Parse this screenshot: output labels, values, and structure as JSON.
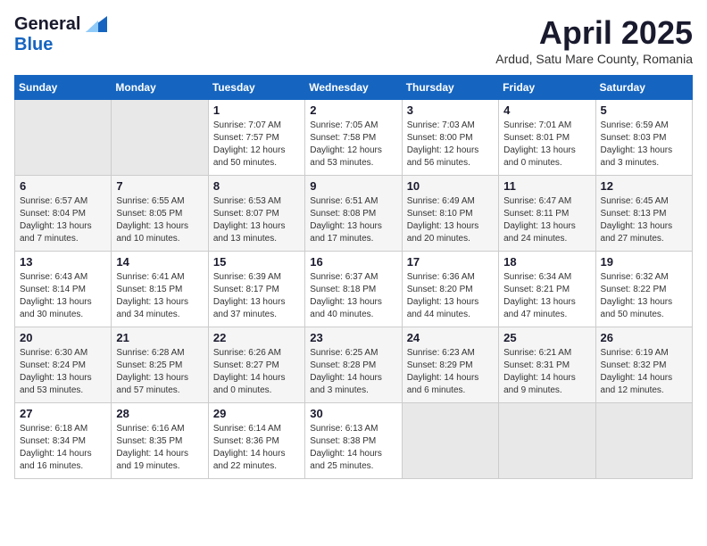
{
  "logo": {
    "general": "General",
    "blue": "Blue"
  },
  "title": {
    "month": "April 2025",
    "location": "Ardud, Satu Mare County, Romania"
  },
  "headers": [
    "Sunday",
    "Monday",
    "Tuesday",
    "Wednesday",
    "Thursday",
    "Friday",
    "Saturday"
  ],
  "weeks": [
    [
      {
        "num": "",
        "sunrise": "",
        "sunset": "",
        "daylight": ""
      },
      {
        "num": "",
        "sunrise": "",
        "sunset": "",
        "daylight": ""
      },
      {
        "num": "1",
        "sunrise": "Sunrise: 7:07 AM",
        "sunset": "Sunset: 7:57 PM",
        "daylight": "Daylight: 12 hours and 50 minutes."
      },
      {
        "num": "2",
        "sunrise": "Sunrise: 7:05 AM",
        "sunset": "Sunset: 7:58 PM",
        "daylight": "Daylight: 12 hours and 53 minutes."
      },
      {
        "num": "3",
        "sunrise": "Sunrise: 7:03 AM",
        "sunset": "Sunset: 8:00 PM",
        "daylight": "Daylight: 12 hours and 56 minutes."
      },
      {
        "num": "4",
        "sunrise": "Sunrise: 7:01 AM",
        "sunset": "Sunset: 8:01 PM",
        "daylight": "Daylight: 13 hours and 0 minutes."
      },
      {
        "num": "5",
        "sunrise": "Sunrise: 6:59 AM",
        "sunset": "Sunset: 8:03 PM",
        "daylight": "Daylight: 13 hours and 3 minutes."
      }
    ],
    [
      {
        "num": "6",
        "sunrise": "Sunrise: 6:57 AM",
        "sunset": "Sunset: 8:04 PM",
        "daylight": "Daylight: 13 hours and 7 minutes."
      },
      {
        "num": "7",
        "sunrise": "Sunrise: 6:55 AM",
        "sunset": "Sunset: 8:05 PM",
        "daylight": "Daylight: 13 hours and 10 minutes."
      },
      {
        "num": "8",
        "sunrise": "Sunrise: 6:53 AM",
        "sunset": "Sunset: 8:07 PM",
        "daylight": "Daylight: 13 hours and 13 minutes."
      },
      {
        "num": "9",
        "sunrise": "Sunrise: 6:51 AM",
        "sunset": "Sunset: 8:08 PM",
        "daylight": "Daylight: 13 hours and 17 minutes."
      },
      {
        "num": "10",
        "sunrise": "Sunrise: 6:49 AM",
        "sunset": "Sunset: 8:10 PM",
        "daylight": "Daylight: 13 hours and 20 minutes."
      },
      {
        "num": "11",
        "sunrise": "Sunrise: 6:47 AM",
        "sunset": "Sunset: 8:11 PM",
        "daylight": "Daylight: 13 hours and 24 minutes."
      },
      {
        "num": "12",
        "sunrise": "Sunrise: 6:45 AM",
        "sunset": "Sunset: 8:13 PM",
        "daylight": "Daylight: 13 hours and 27 minutes."
      }
    ],
    [
      {
        "num": "13",
        "sunrise": "Sunrise: 6:43 AM",
        "sunset": "Sunset: 8:14 PM",
        "daylight": "Daylight: 13 hours and 30 minutes."
      },
      {
        "num": "14",
        "sunrise": "Sunrise: 6:41 AM",
        "sunset": "Sunset: 8:15 PM",
        "daylight": "Daylight: 13 hours and 34 minutes."
      },
      {
        "num": "15",
        "sunrise": "Sunrise: 6:39 AM",
        "sunset": "Sunset: 8:17 PM",
        "daylight": "Daylight: 13 hours and 37 minutes."
      },
      {
        "num": "16",
        "sunrise": "Sunrise: 6:37 AM",
        "sunset": "Sunset: 8:18 PM",
        "daylight": "Daylight: 13 hours and 40 minutes."
      },
      {
        "num": "17",
        "sunrise": "Sunrise: 6:36 AM",
        "sunset": "Sunset: 8:20 PM",
        "daylight": "Daylight: 13 hours and 44 minutes."
      },
      {
        "num": "18",
        "sunrise": "Sunrise: 6:34 AM",
        "sunset": "Sunset: 8:21 PM",
        "daylight": "Daylight: 13 hours and 47 minutes."
      },
      {
        "num": "19",
        "sunrise": "Sunrise: 6:32 AM",
        "sunset": "Sunset: 8:22 PM",
        "daylight": "Daylight: 13 hours and 50 minutes."
      }
    ],
    [
      {
        "num": "20",
        "sunrise": "Sunrise: 6:30 AM",
        "sunset": "Sunset: 8:24 PM",
        "daylight": "Daylight: 13 hours and 53 minutes."
      },
      {
        "num": "21",
        "sunrise": "Sunrise: 6:28 AM",
        "sunset": "Sunset: 8:25 PM",
        "daylight": "Daylight: 13 hours and 57 minutes."
      },
      {
        "num": "22",
        "sunrise": "Sunrise: 6:26 AM",
        "sunset": "Sunset: 8:27 PM",
        "daylight": "Daylight: 14 hours and 0 minutes."
      },
      {
        "num": "23",
        "sunrise": "Sunrise: 6:25 AM",
        "sunset": "Sunset: 8:28 PM",
        "daylight": "Daylight: 14 hours and 3 minutes."
      },
      {
        "num": "24",
        "sunrise": "Sunrise: 6:23 AM",
        "sunset": "Sunset: 8:29 PM",
        "daylight": "Daylight: 14 hours and 6 minutes."
      },
      {
        "num": "25",
        "sunrise": "Sunrise: 6:21 AM",
        "sunset": "Sunset: 8:31 PM",
        "daylight": "Daylight: 14 hours and 9 minutes."
      },
      {
        "num": "26",
        "sunrise": "Sunrise: 6:19 AM",
        "sunset": "Sunset: 8:32 PM",
        "daylight": "Daylight: 14 hours and 12 minutes."
      }
    ],
    [
      {
        "num": "27",
        "sunrise": "Sunrise: 6:18 AM",
        "sunset": "Sunset: 8:34 PM",
        "daylight": "Daylight: 14 hours and 16 minutes."
      },
      {
        "num": "28",
        "sunrise": "Sunrise: 6:16 AM",
        "sunset": "Sunset: 8:35 PM",
        "daylight": "Daylight: 14 hours and 19 minutes."
      },
      {
        "num": "29",
        "sunrise": "Sunrise: 6:14 AM",
        "sunset": "Sunset: 8:36 PM",
        "daylight": "Daylight: 14 hours and 22 minutes."
      },
      {
        "num": "30",
        "sunrise": "Sunrise: 6:13 AM",
        "sunset": "Sunset: 8:38 PM",
        "daylight": "Daylight: 14 hours and 25 minutes."
      },
      {
        "num": "",
        "sunrise": "",
        "sunset": "",
        "daylight": ""
      },
      {
        "num": "",
        "sunrise": "",
        "sunset": "",
        "daylight": ""
      },
      {
        "num": "",
        "sunrise": "",
        "sunset": "",
        "daylight": ""
      }
    ]
  ]
}
